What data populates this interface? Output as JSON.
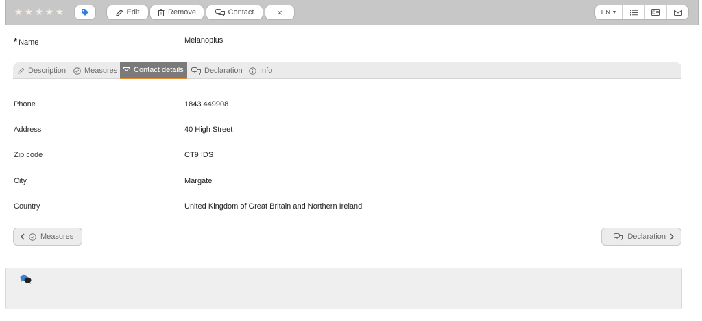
{
  "toolbar": {
    "rating_stars": 5,
    "rating_value": 0,
    "edit_label": "Edit",
    "remove_label": "Remove",
    "contact_label": "Contact",
    "close_label": "×",
    "language": "EN",
    "accent_color": "#2f7fd6"
  },
  "record": {
    "name_label": "Name",
    "name_required_mark": "*",
    "name_value": "Melanoplus"
  },
  "tabs": [
    {
      "label": "Description",
      "icon": "pencil-icon",
      "active": false
    },
    {
      "label": "Measures",
      "icon": "check-circle-icon",
      "active": false
    },
    {
      "label": "Contact details",
      "icon": "envelope-icon",
      "active": true
    },
    {
      "label": "Declaration",
      "icon": "chat-icon",
      "active": false
    },
    {
      "label": "Info",
      "icon": "info-icon",
      "active": false
    }
  ],
  "contact": {
    "fields": [
      {
        "label": "Phone",
        "value": "1843 449908"
      },
      {
        "label": "Address",
        "value": "40 High Street"
      },
      {
        "label": "Zip code",
        "value": "CT9 IDS"
      },
      {
        "label": "City",
        "value": "Margate"
      },
      {
        "label": "Country",
        "value": "United Kingdom of Great Britain and Northern Ireland"
      }
    ]
  },
  "navigation": {
    "prev_label": "Measures",
    "next_label": "Declaration"
  },
  "comments": {
    "icon": "comments-icon"
  }
}
